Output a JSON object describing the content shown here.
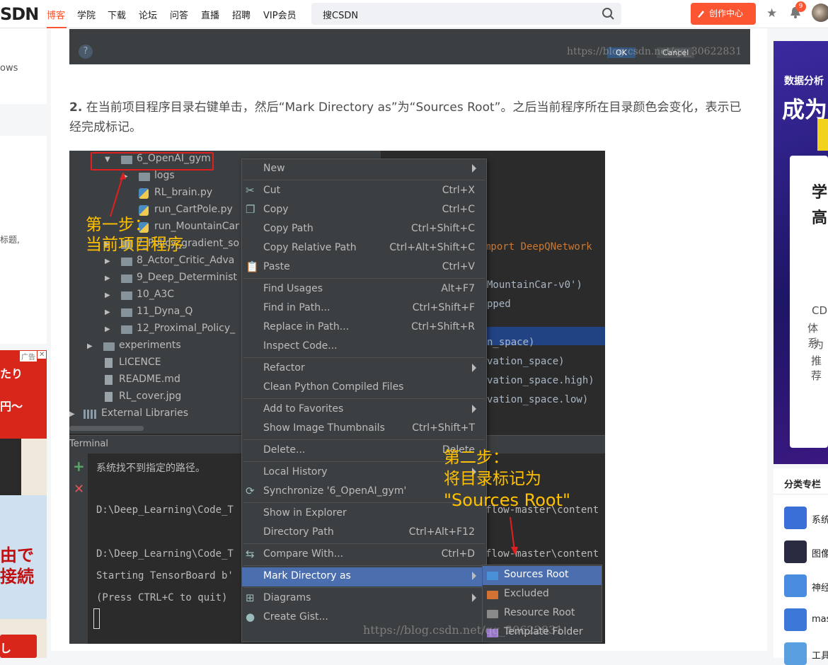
{
  "nav": {
    "logo": "SDN",
    "items": [
      "博客",
      "学院",
      "下载",
      "论坛",
      "问答",
      "直播",
      "招聘",
      "VIP会员"
    ],
    "active_index": 0,
    "search_placeholder": "搜CSDN",
    "create_label": "创作中心",
    "notification_count": "9"
  },
  "left": {
    "snippet1": "ows",
    "snippet2": "标题,",
    "ad_label": "广告",
    "ad_lines": [
      "たり",
      "円〜",
      "由で",
      "接続",
      "し"
    ]
  },
  "article": {
    "top_strip": {
      "ok": "OK",
      "cancel": "Cancel",
      "watermark": "https://blog.csdn.net/qq_30622831"
    },
    "para_num": "2.",
    "para_text": "在当前项目程序目录右键单击，然后“Mark Directory as”为“Sources Root”。之后当前程序所在目录颜色会变化，表示已经完成标记。"
  },
  "ide": {
    "tree": [
      {
        "label": "6_OpenAI_gym",
        "kind": "folder",
        "depth": 1,
        "expanded": true
      },
      {
        "label": "logs",
        "kind": "folder",
        "depth": 2,
        "expanded": false
      },
      {
        "label": "RL_brain.py",
        "kind": "py",
        "depth": 2
      },
      {
        "label": "run_CartPole.py",
        "kind": "py",
        "depth": 2
      },
      {
        "label": "run_MountainCar",
        "kind": "py",
        "depth": 2
      },
      {
        "label": "7_Policy_gradient_so",
        "kind": "folder",
        "depth": 1,
        "expanded": false
      },
      {
        "label": "8_Actor_Critic_Adva",
        "kind": "folder",
        "depth": 1,
        "expanded": false
      },
      {
        "label": "9_Deep_Determinist",
        "kind": "folder",
        "depth": 1,
        "expanded": false
      },
      {
        "label": "10_A3C",
        "kind": "folder",
        "depth": 1,
        "expanded": false
      },
      {
        "label": "11_Dyna_Q",
        "kind": "folder",
        "depth": 1,
        "expanded": false
      },
      {
        "label": "12_Proximal_Policy_",
        "kind": "folder",
        "depth": 1,
        "expanded": false
      },
      {
        "label": "experiments",
        "kind": "folder",
        "depth": 0,
        "expanded": false
      },
      {
        "label": "LICENCE",
        "kind": "doc",
        "depth": 0
      },
      {
        "label": "README.md",
        "kind": "doc",
        "depth": 0
      },
      {
        "label": "RL_cover.jpg",
        "kind": "doc",
        "depth": 0
      },
      {
        "label": "External Libraries",
        "kind": "lib",
        "depth": -1,
        "expanded": false
      }
    ],
    "code_lines": [
      {
        "text": "mport DeepQNetwork",
        "row": 5
      },
      {
        "text": "MountainCar-v0')",
        "row": 7
      },
      {
        "text": "pped",
        "row": 8
      },
      {
        "text": "n_space)",
        "row": 10
      },
      {
        "text": "vation_space)",
        "row": 11
      },
      {
        "text": "vation_space.high)",
        "row": 12
      },
      {
        "text": "vation_space.low)",
        "row": 13
      }
    ],
    "terminal_title": "Terminal",
    "terminal_lines": [
      "系统找不到指定的路径。",
      "",
      "D:\\Deep_Learning\\Code_T",
      "",
      "D:\\Deep_Learning\\Code_T",
      "Starting TensorBoard b'",
      "(Press CTRL+C to quit)"
    ],
    "terminal_tail": [
      "flow-master\\content",
      "flow-master\\content"
    ],
    "menu": [
      {
        "label": "New",
        "shortcut": "",
        "submenu": true
      },
      {
        "sep": true
      },
      {
        "label": "Cut",
        "shortcut": "Ctrl+X",
        "icon": "scissors-icon"
      },
      {
        "label": "Copy",
        "shortcut": "Ctrl+C",
        "icon": "copy-icon"
      },
      {
        "label": "Copy Path",
        "shortcut": "Ctrl+Shift+C"
      },
      {
        "label": "Copy Relative Path",
        "shortcut": "Ctrl+Alt+Shift+C"
      },
      {
        "label": "Paste",
        "shortcut": "Ctrl+V",
        "icon": "paste-icon"
      },
      {
        "sep": true
      },
      {
        "label": "Find Usages",
        "shortcut": "Alt+F7"
      },
      {
        "label": "Find in Path...",
        "shortcut": "Ctrl+Shift+F"
      },
      {
        "label": "Replace in Path...",
        "shortcut": "Ctrl+Shift+R"
      },
      {
        "label": "Inspect Code...",
        "shortcut": ""
      },
      {
        "sep": true
      },
      {
        "label": "Refactor",
        "shortcut": "",
        "submenu": true
      },
      {
        "label": "Clean Python Compiled Files",
        "shortcut": ""
      },
      {
        "sep": true
      },
      {
        "label": "Add to Favorites",
        "shortcut": "",
        "submenu": true
      },
      {
        "label": "Show Image Thumbnails",
        "shortcut": "Ctrl+Shift+T"
      },
      {
        "sep": true
      },
      {
        "label": "Delete...",
        "shortcut": "Delete"
      },
      {
        "sep": true
      },
      {
        "label": "Local History",
        "shortcut": "",
        "submenu": true
      },
      {
        "label": "Synchronize '6_OpenAI_gym'",
        "shortcut": "",
        "icon": "sync-icon"
      },
      {
        "sep": true
      },
      {
        "label": "Show in Explorer",
        "shortcut": ""
      },
      {
        "label": "Directory Path",
        "shortcut": "Ctrl+Alt+F12"
      },
      {
        "sep": true
      },
      {
        "label": "Compare With...",
        "shortcut": "Ctrl+D",
        "icon": "compare-icon"
      },
      {
        "sep": true
      },
      {
        "label": "Mark Directory as",
        "shortcut": "",
        "submenu": true,
        "selected": true
      },
      {
        "sep": true
      },
      {
        "label": "Diagrams",
        "shortcut": "",
        "submenu": true,
        "icon": "diagram-icon"
      },
      {
        "label": "Create Gist...",
        "shortcut": "",
        "icon": "github-icon"
      }
    ],
    "submenu": [
      {
        "label": "Sources Root",
        "color": "#4a90d9",
        "selected": true
      },
      {
        "label": "Excluded",
        "color": "#d47233"
      },
      {
        "label": "Resource Root",
        "color": "#8a8a8a"
      },
      {
        "label": "Template Folder",
        "color": "#9876c9"
      }
    ],
    "anno1": [
      "第一步：",
      "当前项目程序"
    ],
    "anno2": [
      "第二步：",
      "将目录标记为",
      "\"Sources Root\""
    ],
    "watermark": "https://blog.csdn.net/qq_30622831"
  },
  "right": {
    "ad_title1": "数据分析",
    "ad_title2": "成为",
    "card_big": [
      "学",
      "高"
    ],
    "card_small": [
      "CD",
      "体系",
      "为",
      "推荐"
    ],
    "cat_title": "分类专栏",
    "cats": [
      "系统",
      "图像",
      "神经",
      "mas",
      "工具"
    ]
  },
  "colors": {
    "accent": "#fc5531",
    "annotation": "#ffc000",
    "menu_selected": "#4b6eaf"
  }
}
